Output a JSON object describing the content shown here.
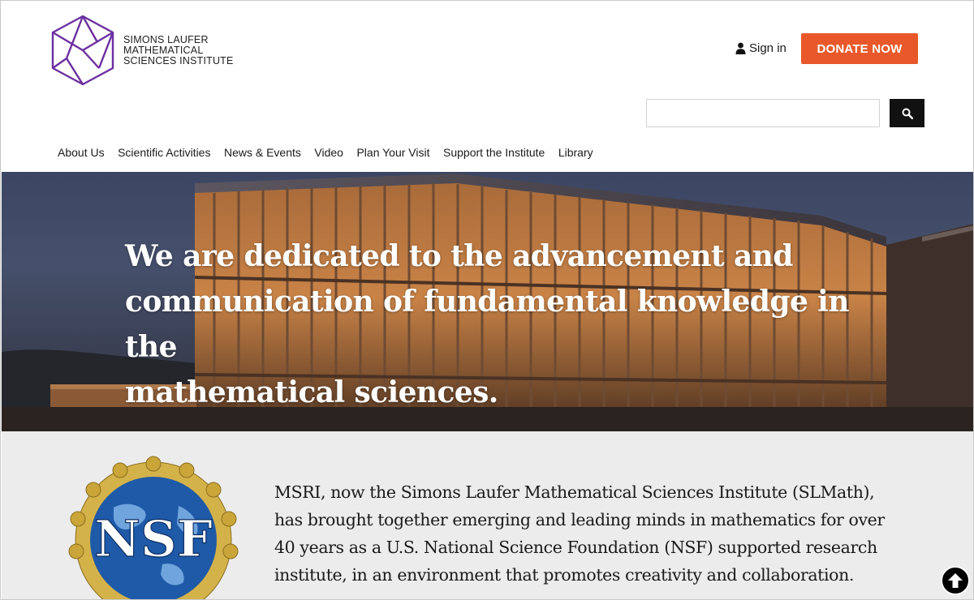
{
  "header": {
    "logo_lines": [
      "SIMONS LAUFER",
      "MATHEMATICAL",
      "SCIENCES INSTITUTE"
    ],
    "signin_label": "Sign in",
    "donate_label": "DONATE NOW",
    "search_placeholder": ""
  },
  "nav": {
    "items": [
      "About Us",
      "Scientific Activities",
      "News & Events",
      "Video",
      "Plan Your Visit",
      "Support the Institute",
      "Library"
    ]
  },
  "hero": {
    "lines": [
      "We are dedicated to the advancement and",
      "communication of fundamental knowledge in the",
      "mathematical sciences."
    ]
  },
  "about": {
    "lines": [
      "MSRI, now the Simons Laufer Mathematical Sciences Institute (SLMath),",
      "has brought together emerging and leading minds in mathematics for over",
      "40 years as a U.S. National Science Foundation (NSF) supported research",
      "institute, in an environment that promotes creativity and collaboration."
    ],
    "nsf_label": "NSF"
  },
  "colors": {
    "brand_purple": "#6b2fa0",
    "donate_orange": "#e8582a",
    "about_bg": "#ececec"
  },
  "icons": {
    "user": "user-icon",
    "search": "search-icon",
    "back_to_top": "arrow-up-circle-icon"
  }
}
